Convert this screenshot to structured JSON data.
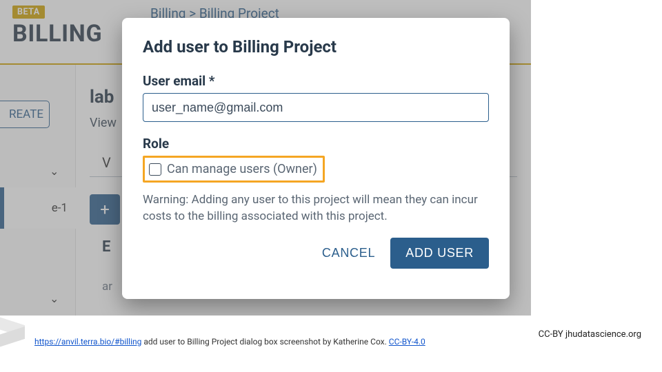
{
  "bg": {
    "beta": "BETA",
    "title": "BILLING",
    "breadcrumb": "Billing > Billing Project",
    "create_label": "REATE",
    "lab": "lab",
    "view": "View",
    "v_frag": "V",
    "e1": "e-1",
    "E": "E",
    "ar": "ar",
    "plus": "+"
  },
  "modal": {
    "title": "Add user to Billing Project",
    "email_label": "User email *",
    "email_value": "user_name@gmail.com",
    "role_label": "Role",
    "role_checkbox_label": "Can manage users (Owner)",
    "warning": "Warning: Adding any user to this project will mean they can incur costs to the billing associated with this project.",
    "cancel": "CANCEL",
    "add": "ADD USER"
  },
  "footer": {
    "url": "https://anvil.terra.bio/#billing",
    "caption_mid": " add user to Billing Project dialog box screenshot by Katherine Cox.  ",
    "license": "CC-BY-4.0",
    "right": "CC-BY  jhudatascience.org"
  },
  "colors": {
    "accent": "#2b5e8c",
    "highlight": "#f5a623",
    "beta_bg": "#d0a200"
  }
}
